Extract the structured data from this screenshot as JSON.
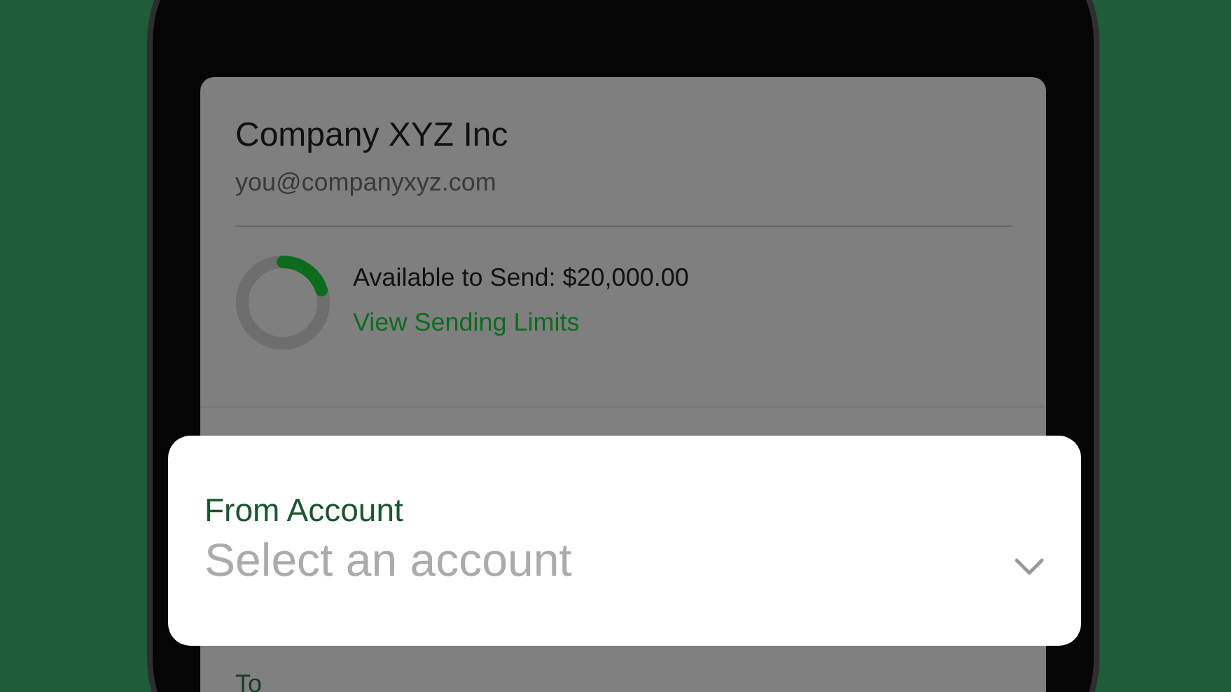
{
  "account": {
    "company": "Company XYZ Inc",
    "email": "you@companyxyz.com"
  },
  "sending": {
    "available": "Available to Send: $20,000.00",
    "link": "View Sending Limits",
    "level": 0.2
  },
  "from_account": {
    "label": "From Account",
    "placeholder": "Select an account"
  },
  "to_field": {
    "label": "To"
  }
}
